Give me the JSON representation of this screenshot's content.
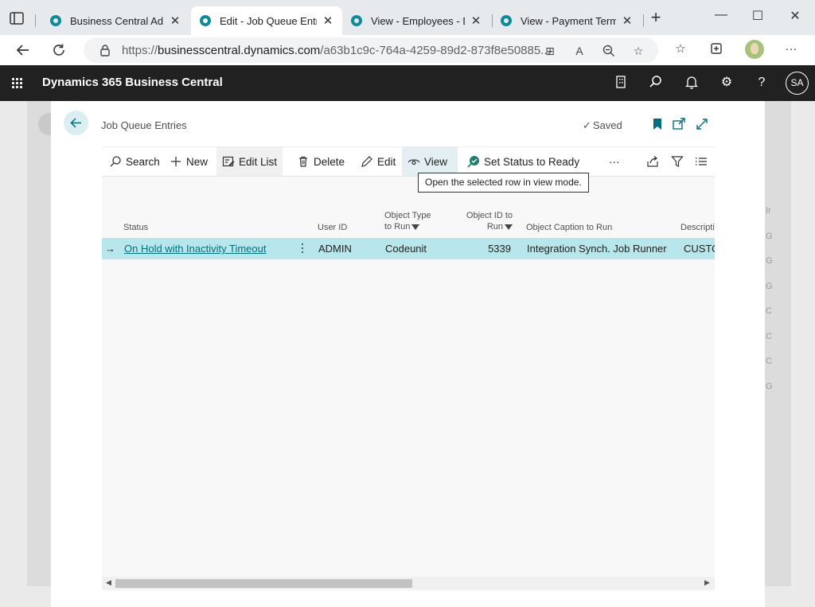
{
  "browser": {
    "tabs": [
      {
        "title": "Business Central Admi",
        "active": false
      },
      {
        "title": "Edit - Job Queue Entrie",
        "active": true
      },
      {
        "title": "View - Employees - Dy",
        "active": false
      },
      {
        "title": "View - Payment Terms",
        "active": false
      }
    ],
    "url_prefix": "https://",
    "url_host": "businesscentral.dynamics.com",
    "url_path": "/a63b1c9c-764a-4259-89d2-873f8e50885..."
  },
  "app": {
    "product_name": "Dynamics 365 Business Central",
    "user_initials": "SA",
    "accent_color": "#00707f",
    "header_color": "#212121",
    "selected_row_color": "#b9e6ea"
  },
  "page": {
    "title": "Job Queue Entries",
    "save_status": "Saved"
  },
  "actions": {
    "search": "Search",
    "new": "New",
    "edit_list": "Edit List",
    "delete": "Delete",
    "edit": "Edit",
    "view": "View",
    "set_status": "Set Status to Ready",
    "more": "···"
  },
  "tooltip": "Open the selected row in view mode.",
  "grid": {
    "columns": {
      "status": "Status",
      "user_id": "User ID",
      "object_type_1": "Object Type",
      "object_type_2": "to Run",
      "object_id_1": "Object ID to",
      "object_id_2": "Run",
      "object_caption": "Object Caption to Run",
      "description": "Descripti"
    },
    "rows": [
      {
        "status": "On Hold with Inactivity Timeout",
        "user_id": "ADMIN",
        "object_type": "Codeunit",
        "object_id": "5339",
        "object_caption": "Integration Synch. Job Runner",
        "description": "CUSTO"
      }
    ]
  },
  "background": {
    "letters": [
      "Ir",
      "G",
      "G",
      "G",
      "C",
      "C",
      "C",
      "G"
    ]
  }
}
